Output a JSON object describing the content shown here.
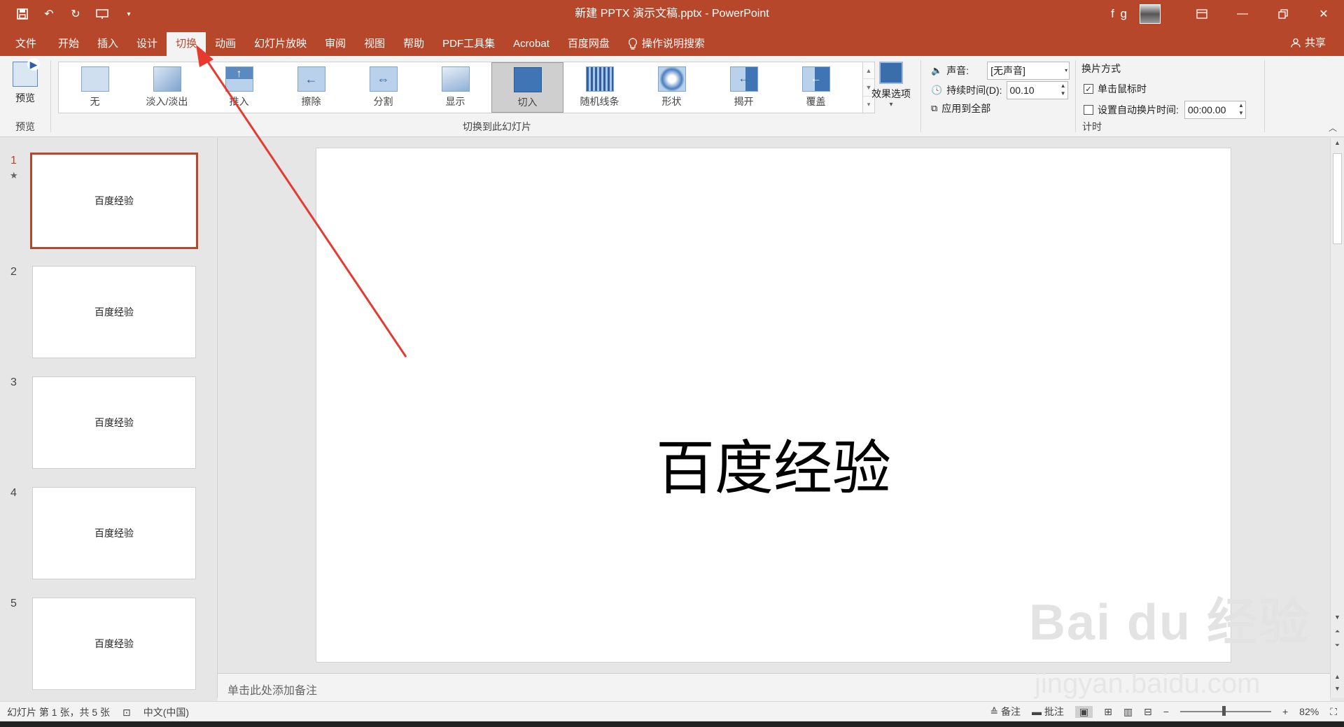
{
  "window": {
    "title": "新建 PPTX 演示文稿.pptx  -  PowerPoint",
    "user": "f g",
    "controls": [
      "ribbon-display",
      "minimize",
      "restore",
      "close"
    ]
  },
  "quick_access": [
    "save-icon",
    "undo-icon",
    "redo-icon",
    "present-icon",
    "customize-icon"
  ],
  "menu": {
    "tabs": [
      "文件",
      "开始",
      "插入",
      "设计",
      "切换",
      "动画",
      "幻灯片放映",
      "审阅",
      "视图",
      "帮助",
      "PDF工具集",
      "Acrobat",
      "百度网盘"
    ],
    "active_tab": "切换",
    "tell_me": "操作说明搜索",
    "share": "共享"
  },
  "ribbon": {
    "preview": {
      "label": "预览",
      "group": "预览"
    },
    "transitions": {
      "group": "切换到此幻灯片",
      "items": [
        "无",
        "淡入/淡出",
        "推入",
        "擦除",
        "分割",
        "显示",
        "切入",
        "随机线条",
        "形状",
        "揭开",
        "覆盖"
      ],
      "selected": "切入"
    },
    "effect_options": "效果选项",
    "timing": {
      "group": "计时",
      "sound_label": "声音:",
      "sound_value": "[无声音]",
      "duration_label": "持续时间(D):",
      "duration_value": "00.10",
      "apply_all": "应用到全部",
      "advance_header": "换片方式",
      "on_click_label": "单击鼠标时",
      "on_click_checked": true,
      "after_label": "设置自动换片时间:",
      "after_checked": false,
      "after_value": "00:00.00"
    }
  },
  "slides": [
    {
      "num": "1",
      "text": "百度经验",
      "active": true,
      "has_transition": "★"
    },
    {
      "num": "2",
      "text": "百度经验",
      "active": false
    },
    {
      "num": "3",
      "text": "百度经验",
      "active": false
    },
    {
      "num": "4",
      "text": "百度经验",
      "active": false
    },
    {
      "num": "5",
      "text": "百度经验",
      "active": false
    }
  ],
  "slide_main": {
    "title": "百度经验"
  },
  "notes": {
    "placeholder": "单击此处添加备注"
  },
  "status": {
    "slide_info": "幻灯片 第 1 张，共 5 张",
    "language": "中文(中国)",
    "notes_btn": "备注",
    "comments_btn": "批注",
    "zoom": "82%"
  },
  "watermark": {
    "main": "Bai du 经验",
    "sub": "jingyan.baidu.com"
  },
  "colors": {
    "accent": "#b7472a",
    "annotation_arrow": "#e8392f"
  }
}
